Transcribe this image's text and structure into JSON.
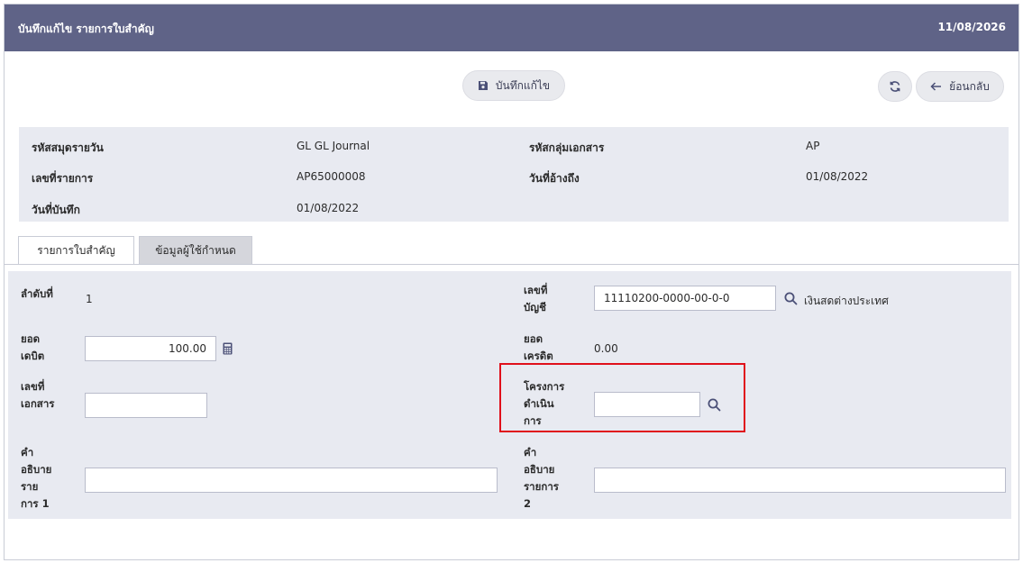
{
  "header": {
    "title": "บันทึกแก้ไข รายการใบสำคัญ",
    "date": "11/08/2026"
  },
  "toolbar": {
    "save_label": "บันทึกแก้ไข",
    "back_label": "ย้อนกลับ"
  },
  "info": {
    "journal_code_label": "รหัสสมุดรายวัน",
    "journal_code_value": "GL GL Journal",
    "doc_group_label": "รหัสกลุ่มเอกสาร",
    "doc_group_value": "AP",
    "txn_no_label": "เลขที่รายการ",
    "txn_no_value": "AP65000008",
    "ref_date_label": "วันที่อ้างถึง",
    "ref_date_value": "01/08/2022",
    "record_date_label": "วันที่บันทึก",
    "record_date_value": "01/08/2022"
  },
  "tabs": [
    {
      "label": "รายการใบสำคัญ"
    },
    {
      "label": "ข้อมูลผู้ใช้กำหนด"
    }
  ],
  "form": {
    "seq_label": "ลำดับที่",
    "seq_value": "1",
    "account_label_1": "เลขที่",
    "account_label_2": "บัญชี",
    "account_value": "11110200-0000-00-0-0",
    "account_name": "เงินสดต่างประเทศ",
    "debit_label_1": "ยอด",
    "debit_label_2": "เดบิต",
    "debit_value": "100.00",
    "credit_label_1": "ยอด",
    "credit_label_2": "เครดิต",
    "credit_value": "0.00",
    "docno_label_1": "เลขที่",
    "docno_label_2": "เอกสาร",
    "docno_value": "",
    "project_label_1": "โครงการ",
    "project_label_2": "ดำเนิน",
    "project_label_3": "การ",
    "project_value": "",
    "desc1_label_1": "คำ",
    "desc1_label_2": "อธิบาย",
    "desc1_label_3": "ราย",
    "desc1_label_4": "การ 1",
    "desc1_value": "",
    "desc2_label_1": "คำ",
    "desc2_label_2": "อธิบาย",
    "desc2_label_3": "รายการ",
    "desc2_label_4": "2",
    "desc2_value": ""
  },
  "colors": {
    "header_bg": "#5f6387",
    "panel_bg": "#e8eaf1",
    "highlight": "#e0101b",
    "icon": "#4b5077"
  }
}
